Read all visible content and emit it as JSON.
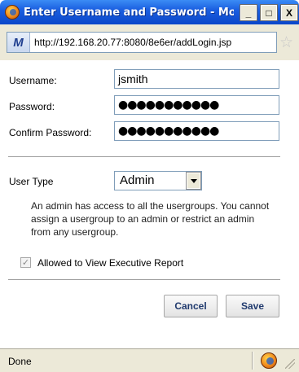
{
  "window": {
    "title": "Enter Username and Password - Mozill...",
    "minimize": "_",
    "maximize": "□",
    "close": "X"
  },
  "address": {
    "url": "http://192.168.20.77:8080/8e6er/addLogin.jsp",
    "site_icon_letter": "M"
  },
  "form": {
    "username_label": "Username:",
    "username_value": "jsmith",
    "password_label": "Password:",
    "password_value": "●●●●●●●●●●●",
    "confirm_label": "Confirm Password:",
    "confirm_value": "●●●●●●●●●●●",
    "user_type_label": "User Type",
    "user_type_value": "Admin",
    "description": "An admin has access to all the usergroups. You cannot assign a usergroup to an admin or restrict an admin from any usergroup.",
    "checkbox_label": "Allowed to View Executive Report",
    "checkbox_checked": true
  },
  "buttons": {
    "cancel": "Cancel",
    "save": "Save"
  },
  "status": {
    "text": "Done"
  },
  "icons": {
    "app": "firefox-icon",
    "site": "site-favicon",
    "star": "bookmark-star-icon",
    "status": "firefox-status-icon"
  }
}
